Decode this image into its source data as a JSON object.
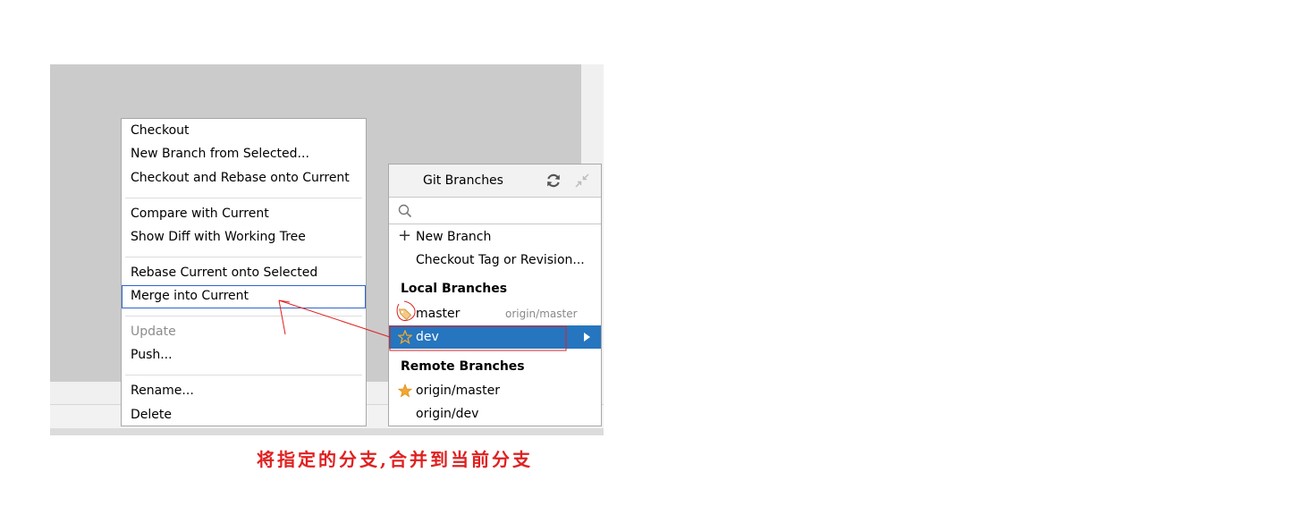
{
  "context_menu": {
    "items": [
      {
        "label": "Checkout",
        "enabled": true
      },
      {
        "label": "New Branch from Selected...",
        "enabled": true
      },
      {
        "label": "Checkout and Rebase onto Current",
        "enabled": true
      },
      {
        "label": "Compare with Current",
        "enabled": true
      },
      {
        "label": "Show Diff with Working Tree",
        "enabled": true
      },
      {
        "label": "Rebase Current onto Selected",
        "enabled": true
      },
      {
        "label": "Merge into Current",
        "enabled": true,
        "selected": true
      },
      {
        "label": "Update",
        "enabled": false
      },
      {
        "label": "Push...",
        "enabled": true
      },
      {
        "label": "Rename...",
        "enabled": true
      },
      {
        "label": "Delete",
        "enabled": true
      }
    ]
  },
  "git_branches": {
    "title": "Git Branches",
    "search_placeholder": "",
    "actions": [
      {
        "label": "New Branch",
        "icon": "plus-icon"
      },
      {
        "label": "Checkout Tag or Revision..."
      }
    ],
    "local_header": "Local Branches",
    "local": [
      {
        "name": "master",
        "tracking": "origin/master",
        "icon": "tag-icon"
      },
      {
        "name": "dev",
        "icon": "star-outline-icon",
        "selected": true
      }
    ],
    "remote_header": "Remote Branches",
    "remote": [
      {
        "name": "origin/master",
        "icon": "star-filled-icon"
      },
      {
        "name": "origin/dev"
      }
    ]
  },
  "caption": "将指定的分支,合并到当前分支",
  "colors": {
    "selection": "#2675bf",
    "annotation": "#e02020",
    "star": "#f0a830",
    "ide_background": "#cbcbcb"
  }
}
